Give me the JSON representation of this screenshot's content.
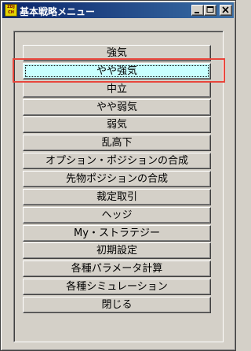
{
  "window": {
    "title": "基本戦略メニュー",
    "app_icon_text": "ZDJ\nCH",
    "title_gradient": [
      "#0a246a",
      "#3a6ea5"
    ]
  },
  "menu": {
    "items": [
      {
        "label": "強気"
      },
      {
        "label": "やや強気",
        "selected": true
      },
      {
        "label": "中立"
      },
      {
        "label": "やや弱気"
      },
      {
        "label": "弱気"
      },
      {
        "label": "乱高下"
      },
      {
        "label": "オプション・ポジションの合成"
      },
      {
        "label": "先物ポジションの合成"
      },
      {
        "label": "裁定取引"
      },
      {
        "label": "ヘッジ"
      },
      {
        "label": "My・ストラテジー"
      },
      {
        "label": "初期設定"
      },
      {
        "label": "各種パラメータ計算"
      },
      {
        "label": "各種シミュレーション"
      },
      {
        "label": "閉じる"
      }
    ],
    "selected_color": "#c8ffff",
    "highlight_color": "#e8463c"
  }
}
